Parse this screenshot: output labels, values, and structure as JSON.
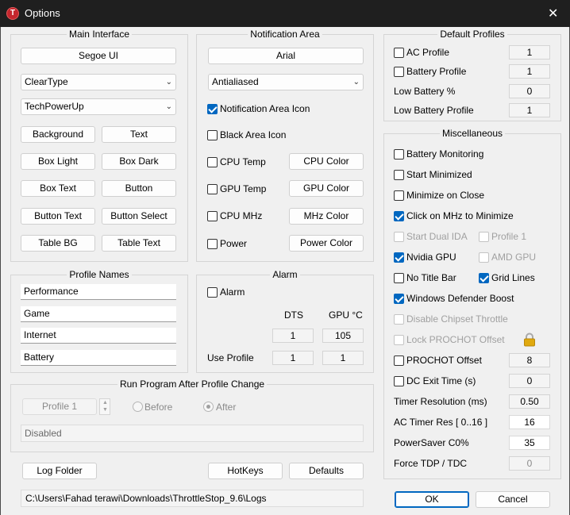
{
  "window": {
    "title": "Options",
    "close_glyph": "✕",
    "icon_letter": "T"
  },
  "main_interface": {
    "title": "Main Interface",
    "font": "Segoe UI",
    "render_mode": "ClearType",
    "skin": "TechPowerUp",
    "buttons": [
      "Background",
      "Text",
      "Box Light",
      "Box Dark",
      "Box Text",
      "Button",
      "Button Text",
      "Button Select",
      "Table BG",
      "Table Text"
    ]
  },
  "notification_area": {
    "title": "Notification Area",
    "font": "Arial",
    "render_mode": "Antialiased",
    "icon_label": "Notification Area Icon",
    "icon_checked": true,
    "black_label": "Black Area Icon",
    "black_checked": false,
    "cpu_temp": "CPU Temp",
    "cpu_color": "CPU Color",
    "gpu_temp": "GPU Temp",
    "gpu_color": "GPU Color",
    "cpu_mhz": "CPU MHz",
    "mhz_color": "MHz Color",
    "power": "Power",
    "power_color": "Power Color"
  },
  "profile_names": {
    "title": "Profile Names",
    "names": [
      "Performance",
      "Game",
      "Internet",
      "Battery"
    ]
  },
  "alarm": {
    "title": "Alarm",
    "alarm_label": "Alarm",
    "dts_header": "DTS",
    "gpu_header": "GPU °C",
    "dts_value": "1",
    "gpu_value": "105",
    "use_profile_label": "Use Profile",
    "use_profile_dts": "1",
    "use_profile_gpu": "1"
  },
  "run_program": {
    "title": "Run Program After Profile Change",
    "profile": "Profile 1",
    "before": "Before",
    "after": "After",
    "path": "Disabled"
  },
  "default_profiles": {
    "title": "Default Profiles",
    "ac_profile": "AC Profile",
    "ac_value": "1",
    "battery_profile": "Battery Profile",
    "battery_value": "1",
    "low_battery_pct": "Low Battery %",
    "low_battery_pct_value": "0",
    "low_battery_profile": "Low Battery Profile",
    "low_battery_profile_value": "1"
  },
  "misc": {
    "title": "Miscellaneous",
    "battery_monitoring": "Battery Monitoring",
    "start_minimized": "Start Minimized",
    "minimize_on_close": "Minimize on Close",
    "click_mhz": "Click on MHz to Minimize",
    "start_dual_ida": "Start Dual IDA",
    "profile_1": "Profile 1",
    "nvidia_gpu": "Nvidia GPU",
    "amd_gpu": "AMD GPU",
    "no_title_bar": "No Title Bar",
    "grid_lines": "Grid Lines",
    "windows_defender": "Windows Defender Boost",
    "disable_chipset": "Disable Chipset Throttle",
    "lock_prochot": "Lock PROCHOT Offset",
    "prochot_offset": "PROCHOT Offset",
    "prochot_value": "8",
    "dc_exit": "DC Exit Time (s)",
    "dc_exit_value": "0",
    "timer_resolution": "Timer Resolution (ms)",
    "timer_resolution_value": "0.50",
    "ac_timer_res": "AC Timer Res [ 0..16 ]",
    "ac_timer_res_value": "16",
    "powersaver": "PowerSaver C0%",
    "powersaver_value": "35",
    "force_tdp": "Force TDP / TDC",
    "force_tdp_value": "0"
  },
  "footer": {
    "log_folder": "Log Folder",
    "hotkeys": "HotKeys",
    "defaults": "Defaults",
    "ok": "OK",
    "cancel": "Cancel",
    "log_path": "C:\\Users\\Fahad terawi\\Downloads\\ThrottleStop_9.6\\Logs"
  },
  "colors": {
    "accent": "#0067c0",
    "titlebar": "#1f1f1f",
    "window_bg": "#f0f0f0",
    "lock": "#e0a90e"
  }
}
